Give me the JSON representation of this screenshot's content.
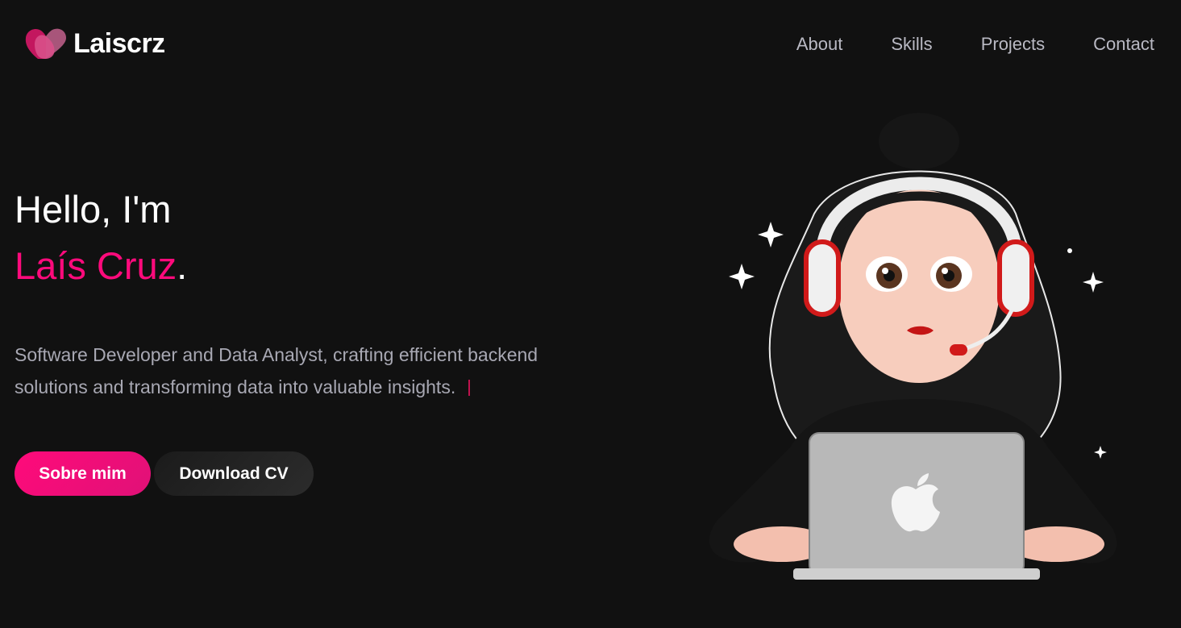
{
  "header": {
    "logo_text": "Laiscrz",
    "nav": [
      {
        "label": "About"
      },
      {
        "label": "Skills"
      },
      {
        "label": "Projects"
      },
      {
        "label": "Contact"
      }
    ]
  },
  "hero": {
    "greeting": "Hello, I'm",
    "name": "Laís Cruz",
    "name_suffix": ".",
    "description": "Software Developer and Data Analyst, crafting efficient backend solutions and transforming data into valuable insights.",
    "primary_button": "Sobre mim",
    "secondary_button": "Download CV"
  },
  "colors": {
    "accent": "#ff0a7c",
    "background": "#111111",
    "nav_text": "#b9b9c3"
  },
  "icons": {
    "logo": "heart-icon",
    "illustration": "avatar-illustration"
  }
}
